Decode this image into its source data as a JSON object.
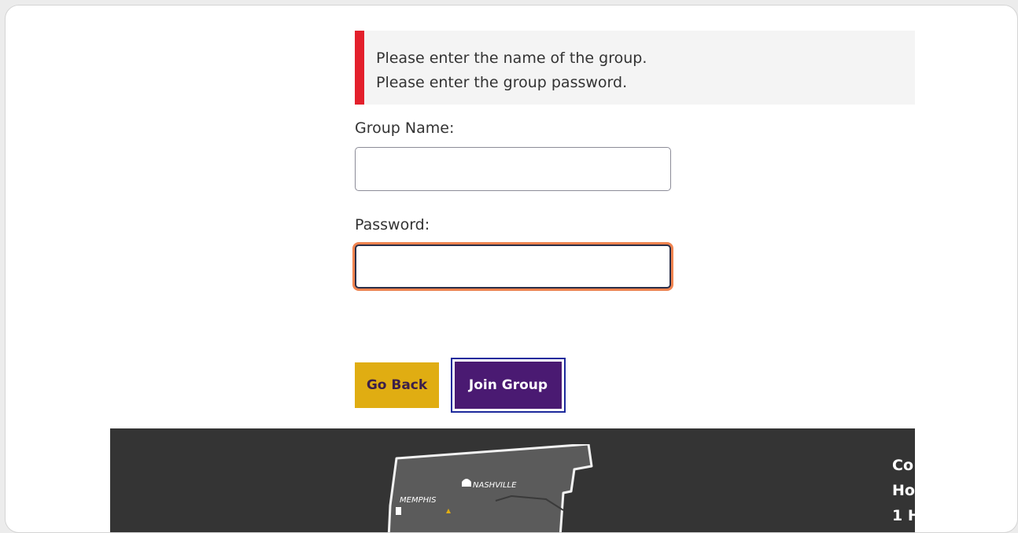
{
  "errors": [
    "Please enter the name of the group.",
    "Please enter the group password."
  ],
  "form": {
    "group_name_label": "Group Name:",
    "group_name_value": "",
    "password_label": "Password:",
    "password_value": ""
  },
  "buttons": {
    "back": "Go Back",
    "join": "Join Group"
  },
  "footer": {
    "map_labels": [
      "NASHVILLE",
      "MEMPHIS"
    ],
    "text_lines": [
      "Co",
      "Ho",
      "1 H"
    ]
  },
  "colors": {
    "error_accent": "#e3202c",
    "back_button": "#e0ad12",
    "join_button": "#4a1a72",
    "focus_ring": "#f0834f",
    "footer_bg": "#343434"
  }
}
